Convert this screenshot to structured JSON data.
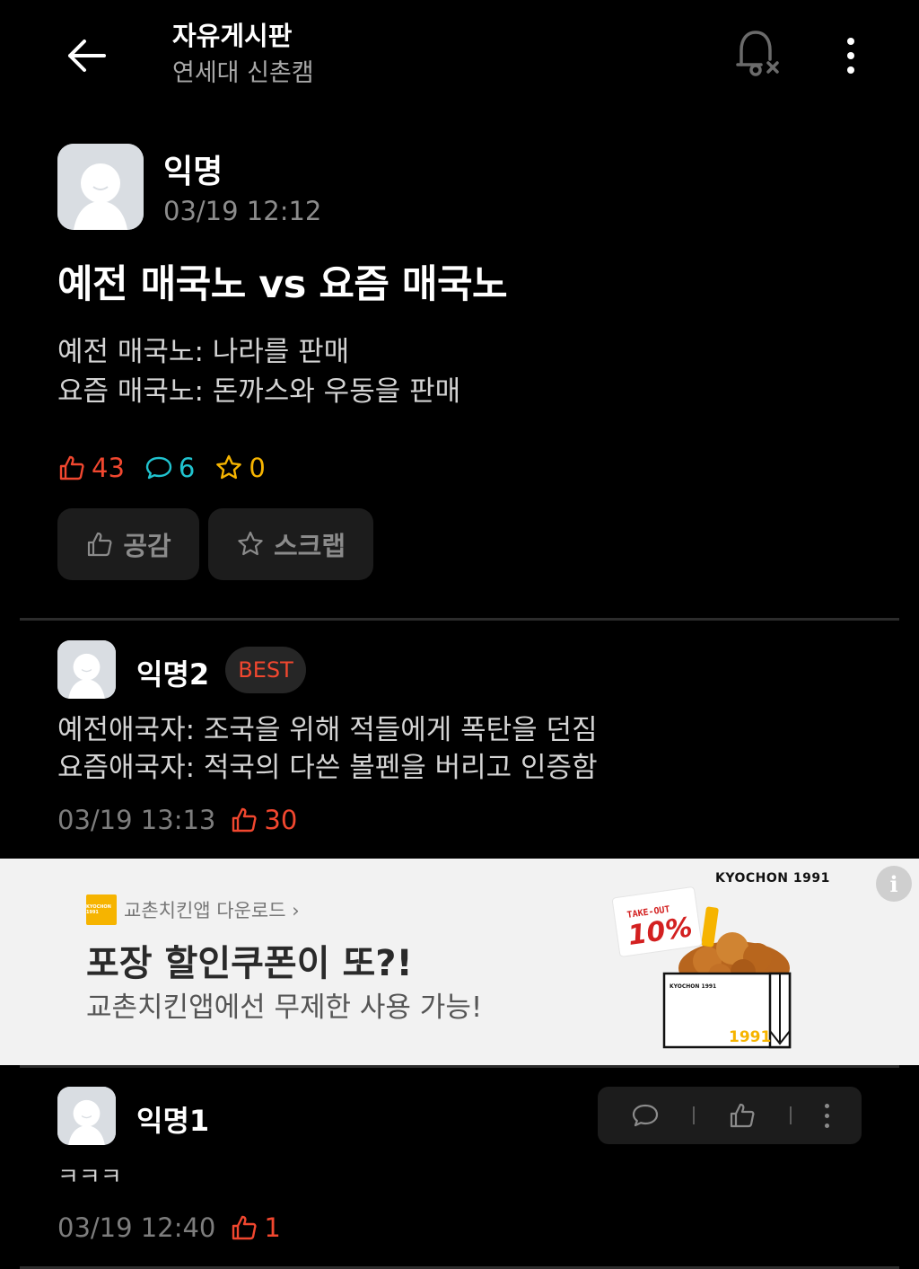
{
  "header": {
    "title": "자유게시판",
    "subtitle": "연세대 신촌캠"
  },
  "post": {
    "author": "익명",
    "time": "03/19 12:12",
    "title": "예전 매국노 vs 요즘 매국노",
    "body": "예전 매국노: 나라를 판매\n요즘 매국노: 돈까스와 우동을 판매",
    "likes": "43",
    "comments": "6",
    "scraps": "0",
    "like_button": "공감",
    "scrap_button": "스크랩"
  },
  "comments": [
    {
      "author": "익명2",
      "badge": "BEST",
      "body": "예전애국자: 조국을 위해 적들에게 폭탄을 던짐\n요즘애국자: 적국의 다쓴 볼펜을 버리고 인증함",
      "time": "03/19 13:13",
      "likes": "30"
    },
    {
      "author": "익명1",
      "body": "ㅋㅋㅋ",
      "time": "03/19 12:40",
      "likes": "1"
    }
  ],
  "ad": {
    "brand": "교촌치킨앱 다운로드 ›",
    "headline": "포장 할인쿠폰이 또?!",
    "subtext": "교촌치킨앱에선 무제한 사용 가능!",
    "logo_text": "KYOCHON 1991",
    "box_label": "KYOCHON 1991",
    "box_year": "1991",
    "coupon_top": "TAKE-OUT",
    "coupon_percent": "10%",
    "info_label": "i"
  },
  "colors": {
    "accent_red": "#f1472f",
    "accent_teal": "#20c3cf",
    "accent_yellow": "#f6b400",
    "background": "#000000"
  },
  "icons": [
    "arrow-left-icon",
    "bell-off-icon",
    "more-vertical-icon",
    "thumbs-up-icon",
    "comment-icon",
    "star-icon",
    "info-icon"
  ]
}
